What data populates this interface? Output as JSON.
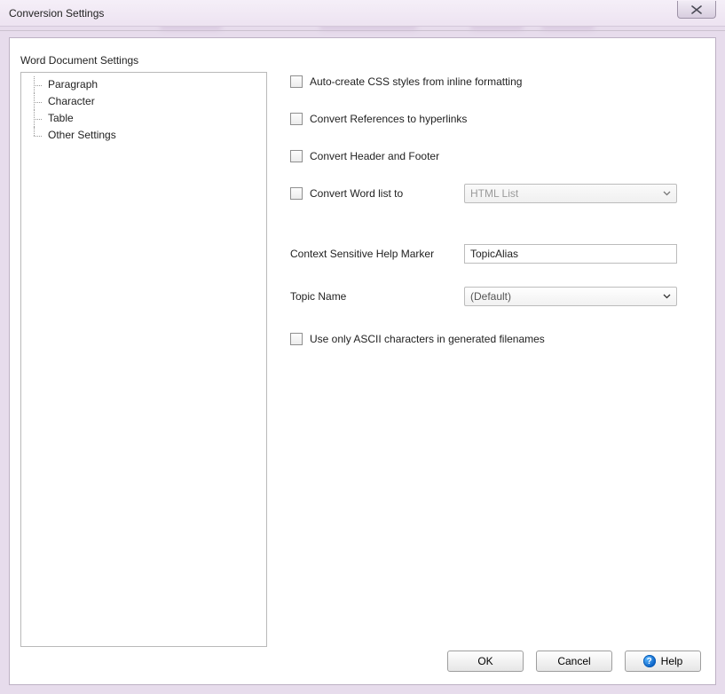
{
  "window": {
    "title": "Conversion Settings"
  },
  "sidebar": {
    "heading": "Word Document Settings",
    "items": [
      {
        "label": "Paragraph"
      },
      {
        "label": "Character"
      },
      {
        "label": "Table"
      },
      {
        "label": "Other Settings"
      }
    ]
  },
  "form": {
    "auto_css_label": "Auto-create CSS styles from inline formatting",
    "convert_refs_label": "Convert References to hyperlinks",
    "convert_header_footer_label": "Convert Header and Footer",
    "convert_word_list_label": "Convert Word list to",
    "word_list_dropdown_value": "HTML List",
    "context_marker_label": "Context Sensitive Help Marker",
    "context_marker_value": "TopicAlias",
    "topic_name_label": "Topic Name",
    "topic_name_value": "(Default)",
    "ascii_filenames_label": "Use only ASCII characters in generated filenames"
  },
  "buttons": {
    "ok": "OK",
    "cancel": "Cancel",
    "help": "Help"
  }
}
